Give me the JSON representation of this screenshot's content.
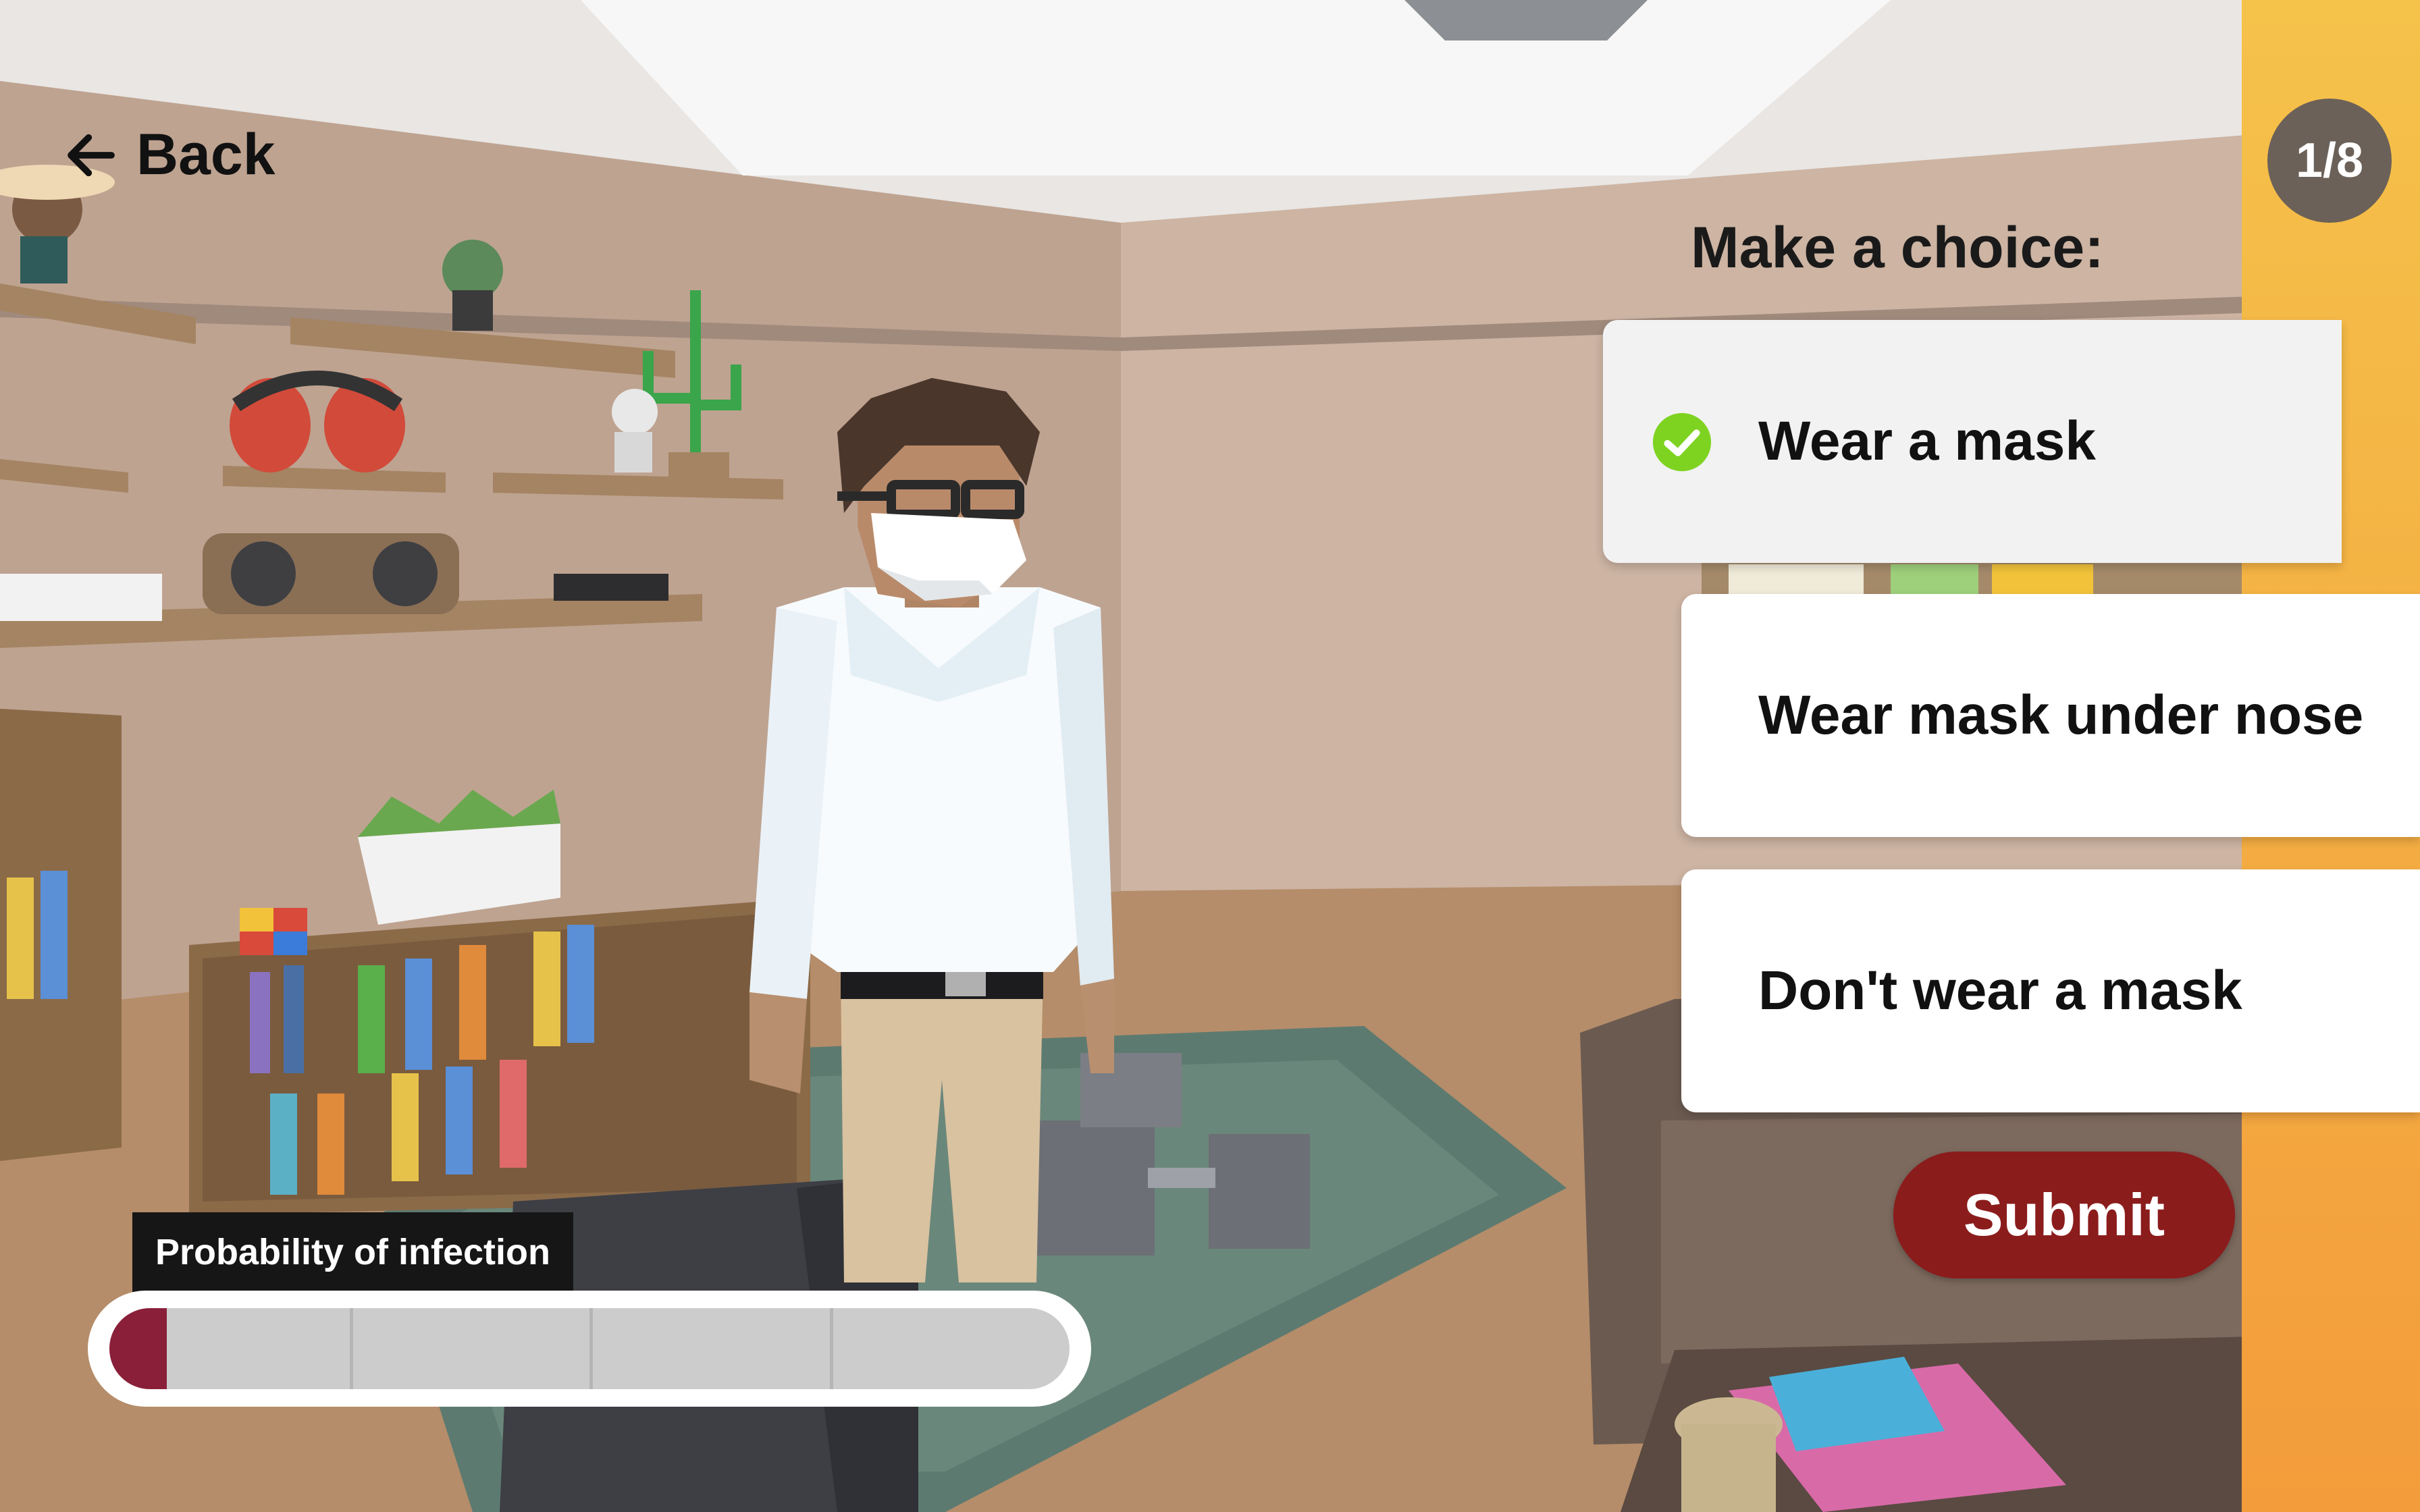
{
  "nav": {
    "back_label": "Back"
  },
  "progress": {
    "step_label": "1/8",
    "current_step": 1,
    "total_steps": 8
  },
  "choice_panel": {
    "prompt": "Make a choice:",
    "options": [
      {
        "label": "Wear a mask",
        "selected": true
      },
      {
        "label": "Wear mask under nose",
        "selected": false
      },
      {
        "label": "Don't wear a mask",
        "selected": false
      }
    ],
    "submit_label": "Submit"
  },
  "infection_meter": {
    "label": "Probability of infection",
    "value": 0.06,
    "segments": 4
  },
  "colors": {
    "accent_orange": "#f5b942",
    "submit_red": "#8b1c1c",
    "meter_fill": "#8a1f3a",
    "check_green": "#7ed321"
  },
  "icons": {
    "back": "arrow-left-icon",
    "selected": "check-circle-icon"
  }
}
